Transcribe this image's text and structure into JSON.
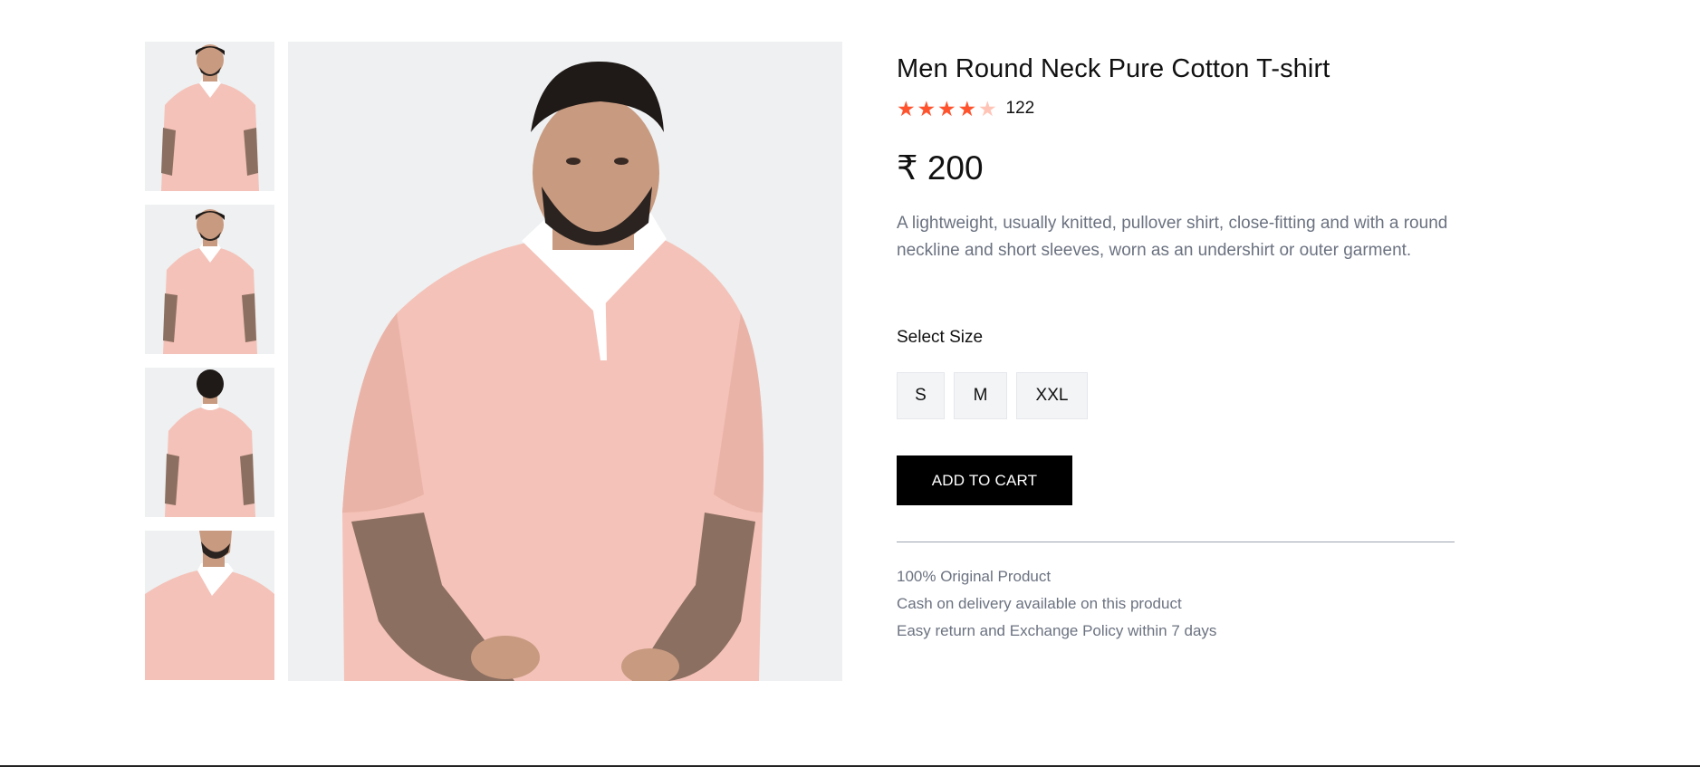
{
  "product": {
    "title": "Men Round Neck Pure Cotton T-shirt",
    "rating": {
      "stars_filled": 4,
      "stars_total": 5,
      "review_count": "122"
    },
    "price": "₹ 200",
    "description": "A lightweight, usually knitted, pullover shirt, close-fitting and with a round neckline and short sleeves, worn as an undershirt or outer garment.",
    "size_label": "Select Size",
    "sizes": [
      "S",
      "M",
      "XXL"
    ],
    "add_to_cart_label": "ADD TO CART",
    "policies": [
      "100% Original Product",
      "Cash on delivery available on this product",
      "Easy return and Exchange Policy within 7 days"
    ]
  },
  "colors": {
    "star_filled": "#ff532e",
    "star_empty": "#ffc4b6",
    "shirt": "#f4c2b8",
    "cart_button": "#000000"
  },
  "icons": {
    "star": "star-icon"
  }
}
